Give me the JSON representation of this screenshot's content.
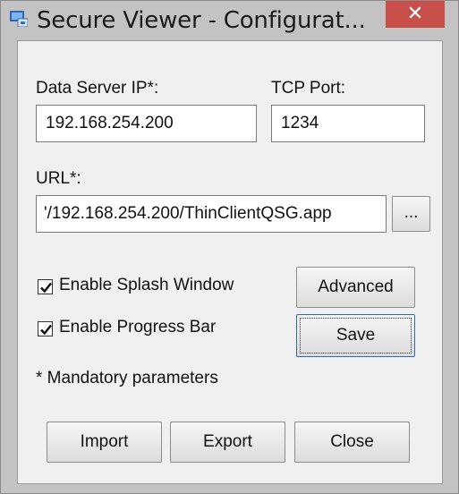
{
  "window": {
    "title": "Secure Viewer - Configurat...",
    "close_label": "✕"
  },
  "form": {
    "data_server_ip_label": "Data Server IP*:",
    "data_server_ip_value": "192.168.254.200",
    "tcp_port_label": "TCP Port:",
    "tcp_port_value": "1234",
    "url_label": "URL*:",
    "url_value": "'/192.168.254.200/ThinClientQSG.app",
    "browse_label": "...",
    "enable_splash_label": "Enable Splash Window",
    "enable_splash_checked": true,
    "enable_progress_label": "Enable Progress Bar",
    "enable_progress_checked": true,
    "mandatory_note": "* Mandatory parameters"
  },
  "buttons": {
    "advanced": "Advanced",
    "save": "Save",
    "import": "Import",
    "export": "Export",
    "close": "Close"
  },
  "colors": {
    "close_button": "#c9504a",
    "window_frame": "#c3c3c3",
    "client_area": "#f0f0f0",
    "default_button_border": "#2d6bb5"
  },
  "icons": {
    "app_icon": "monitor-icon",
    "check_icon": "checkmark-icon"
  }
}
